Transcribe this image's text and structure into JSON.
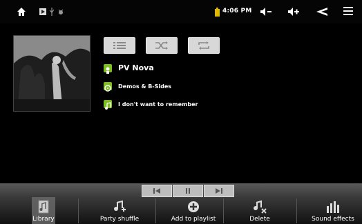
{
  "status_bar": {
    "time": "4:06 PM",
    "icons": [
      "home-icon",
      "notification-icon",
      "usb-icon",
      "debug-icon",
      "battery-icon",
      "volume-down-icon",
      "volume-up-icon",
      "back-icon",
      "menu-icon"
    ]
  },
  "controls": [
    "list-icon",
    "shuffle-icon",
    "repeat-icon"
  ],
  "track": {
    "artist": "PV Nova",
    "album": "Demos & B-Sides",
    "title": "I don't want to remember"
  },
  "transport": [
    "previous-icon",
    "pause-icon",
    "next-icon"
  ],
  "tabs": [
    {
      "label": "Library",
      "icon": "library-icon"
    },
    {
      "label": "Party shuffle",
      "icon": "party-shuffle-icon"
    },
    {
      "label": "Add to playlist",
      "icon": "add-to-playlist-icon"
    },
    {
      "label": "Delete",
      "icon": "delete-icon"
    },
    {
      "label": "Sound effects",
      "icon": "sound-effects-icon"
    }
  ],
  "colors": {
    "accent": "#7cbf1e",
    "battery": "#e0b800"
  }
}
